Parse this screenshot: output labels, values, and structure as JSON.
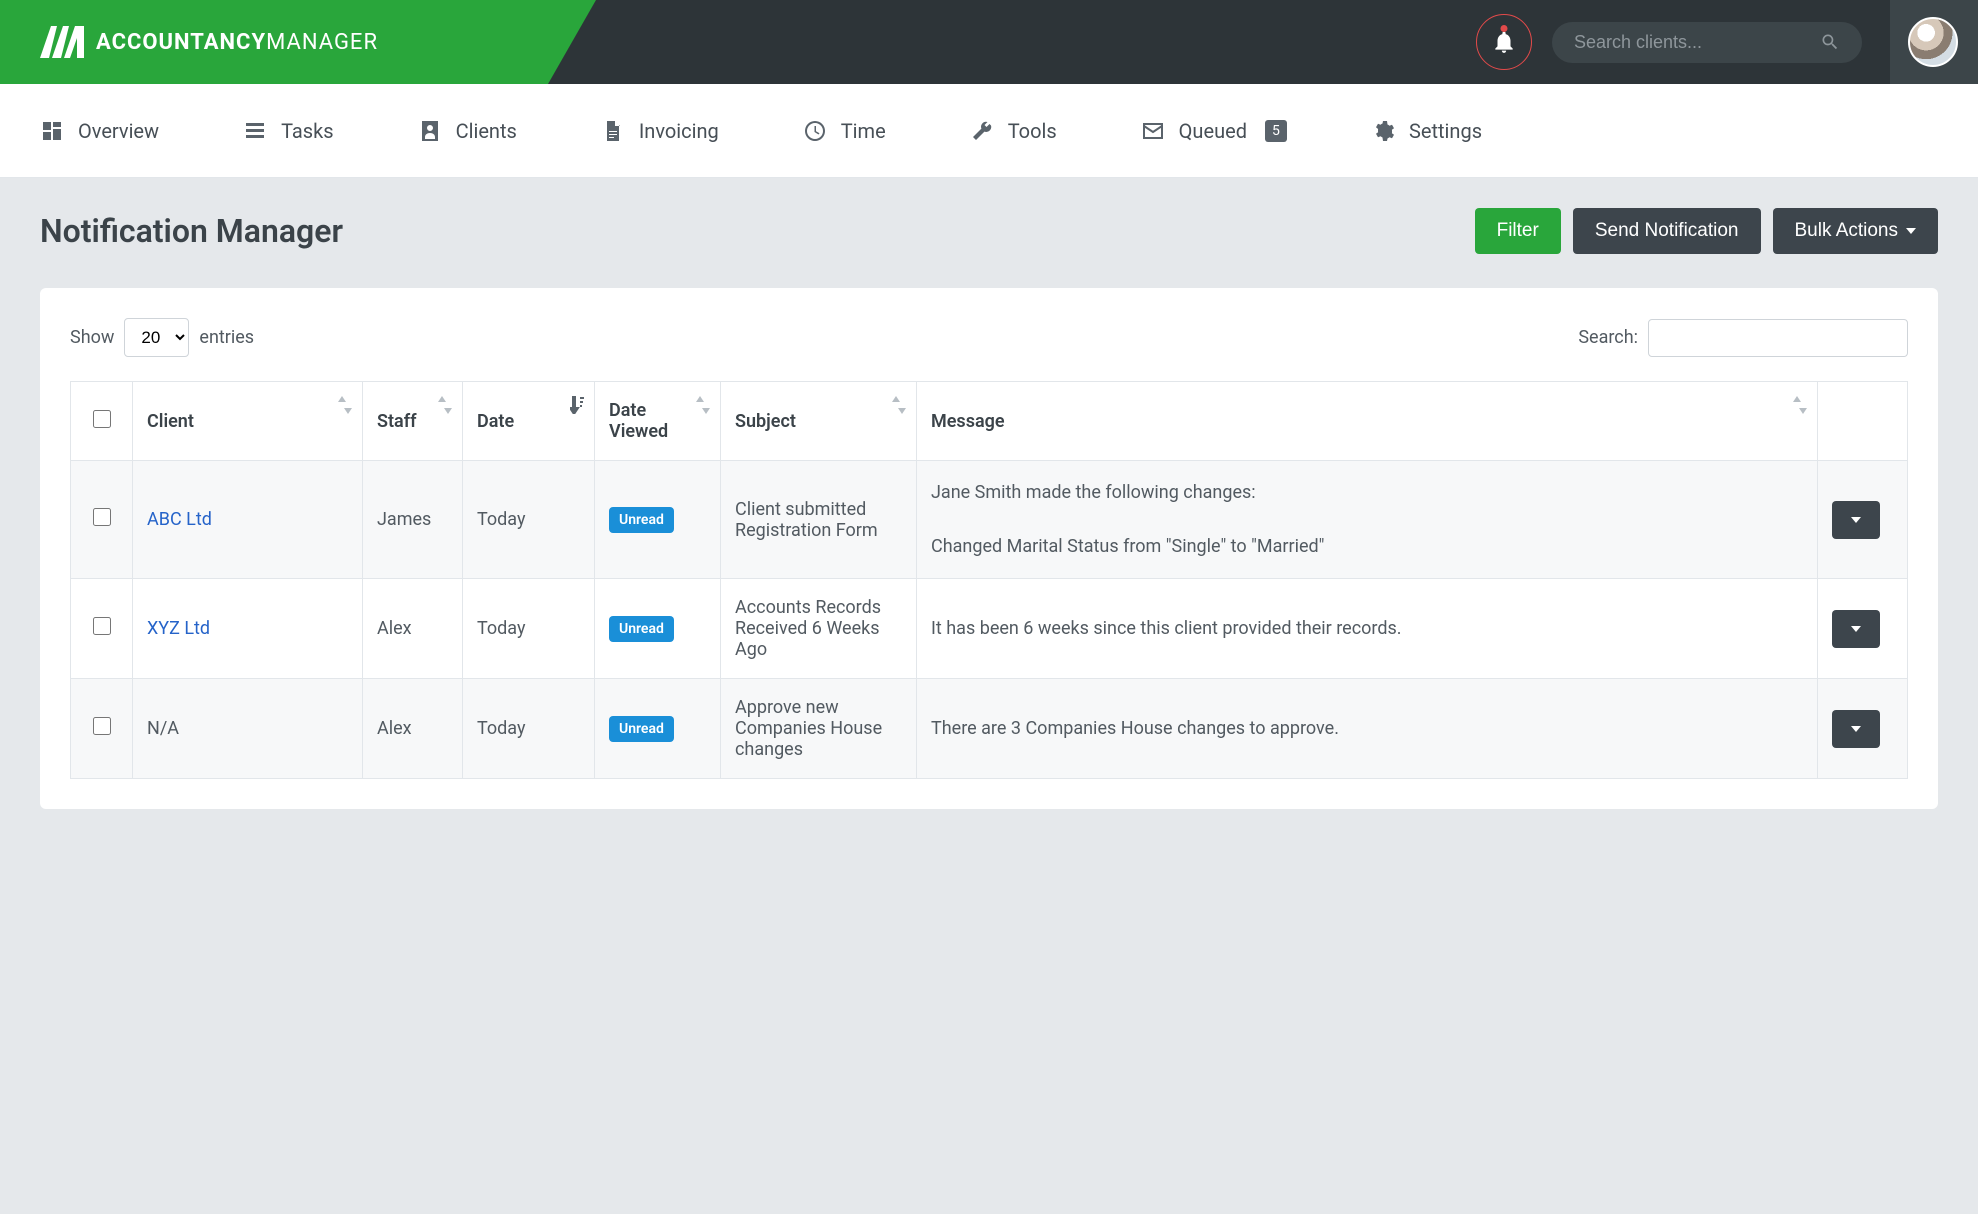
{
  "brand": {
    "name_bold": "ACCOUNTANCY",
    "name_light": "MANAGER"
  },
  "header": {
    "search_placeholder": "Search clients..."
  },
  "nav": [
    {
      "label": "Overview",
      "icon": "dashboard"
    },
    {
      "label": "Tasks",
      "icon": "tasks"
    },
    {
      "label": "Clients",
      "icon": "contacts"
    },
    {
      "label": "Invoicing",
      "icon": "document"
    },
    {
      "label": "Time",
      "icon": "clock"
    },
    {
      "label": "Tools",
      "icon": "wrench"
    },
    {
      "label": "Queued",
      "icon": "mail",
      "badge": "5"
    },
    {
      "label": "Settings",
      "icon": "gear"
    }
  ],
  "page": {
    "title": "Notification Manager",
    "buttons": {
      "filter": "Filter",
      "send": "Send Notification",
      "bulk": "Bulk Actions"
    }
  },
  "table": {
    "show_prefix": "Show",
    "show_suffix": "entries",
    "show_value": "20",
    "search_label": "Search:",
    "columns": {
      "client": "Client",
      "staff": "Staff",
      "date": "Date",
      "date_viewed": "Date Viewed",
      "subject": "Subject",
      "message": "Message"
    },
    "unread_label": "Unread",
    "rows": [
      {
        "client": "ABC Ltd",
        "client_link": true,
        "staff": "James",
        "date": "Today",
        "viewed": "Unread",
        "subject": "Client submitted Registration Form",
        "message": "Jane Smith made the following changes:\n\nChanged Marital Status from \"Single\" to \"Married\""
      },
      {
        "client": "XYZ Ltd",
        "client_link": true,
        "staff": "Alex",
        "date": "Today",
        "viewed": "Unread",
        "subject": "Accounts Records Received 6 Weeks Ago",
        "message": "It has been 6 weeks since this client provided their records."
      },
      {
        "client": "N/A",
        "client_link": false,
        "staff": "Alex",
        "date": "Today",
        "viewed": "Unread",
        "subject": "Approve new Companies House changes",
        "message": "There are 3 Companies House changes to approve."
      }
    ]
  }
}
